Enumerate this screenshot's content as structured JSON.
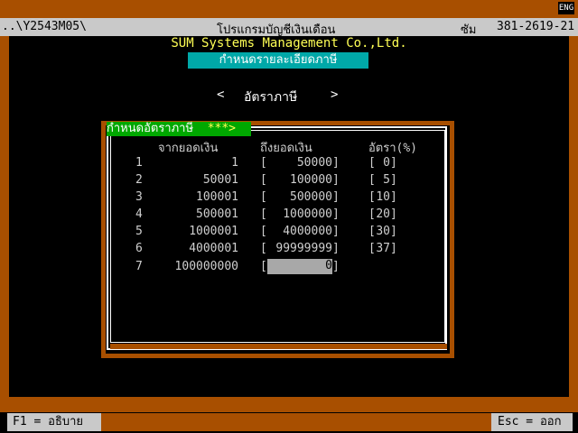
{
  "title_bar": {
    "path": "..\\Y2543M05\\",
    "program_name": "โปรแกรมบัญชีเงินเดือน",
    "room_label": "ซัม",
    "phone": "381-2619-21",
    "input_mode": "ENG"
  },
  "company": "SUM Systems Management Co.,Ltd.",
  "subtitle": "กำหนดรายละเอียดภาษี",
  "nav": {
    "prev": "<",
    "label": "อัตราภาษี",
    "next": ">"
  },
  "dialog": {
    "title": "กำหนดอัตราภาษี",
    "title_suffix": "***>",
    "headers": {
      "from": "จากยอดเงิน",
      "to": "ถึงยอดเงิน",
      "rate": "อัตรา(%)"
    },
    "rows": [
      {
        "no": "1",
        "from": "1",
        "to": "50000",
        "rate": "0"
      },
      {
        "no": "2",
        "from": "50001",
        "to": "100000",
        "rate": "5"
      },
      {
        "no": "3",
        "from": "100001",
        "to": "500000",
        "rate": "10"
      },
      {
        "no": "4",
        "from": "500001",
        "to": "1000000",
        "rate": "20"
      },
      {
        "no": "5",
        "from": "1000001",
        "to": "4000000",
        "rate": "30"
      },
      {
        "no": "6",
        "from": "4000001",
        "to": "99999999",
        "rate": "37"
      }
    ],
    "edit_row": {
      "no": "7",
      "from": "100000000",
      "to": "0"
    }
  },
  "status": {
    "f1": "F1 = อธิบาย",
    "esc": "Esc = ออก"
  }
}
